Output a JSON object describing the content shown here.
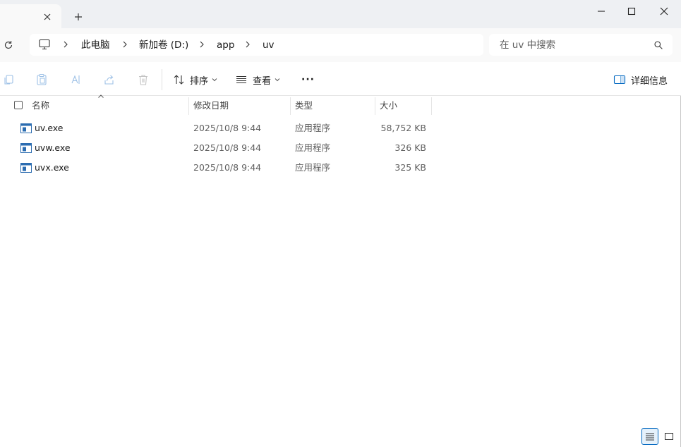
{
  "window": {
    "new_tab_label": "+"
  },
  "address": {
    "crumbs": [
      "此电脑",
      "新加卷 (D:)",
      "app",
      "uv"
    ]
  },
  "search": {
    "placeholder": "在 uv 中搜索"
  },
  "toolbar": {
    "sort_label": "排序",
    "view_label": "查看",
    "more_label": "···",
    "details_label": "详细信息"
  },
  "columns": {
    "name": "名称",
    "date": "修改日期",
    "type": "类型",
    "size": "大小"
  },
  "files": [
    {
      "name": "uv.exe",
      "date": "2025/10/8 9:44",
      "type": "应用程序",
      "size": "58,752 KB"
    },
    {
      "name": "uvw.exe",
      "date": "2025/10/8 9:44",
      "type": "应用程序",
      "size": "326 KB"
    },
    {
      "name": "uvx.exe",
      "date": "2025/10/8 9:44",
      "type": "应用程序",
      "size": "325 KB"
    }
  ],
  "colors": {
    "accent": "#0067c0",
    "titlebar": "#eef0f3"
  }
}
